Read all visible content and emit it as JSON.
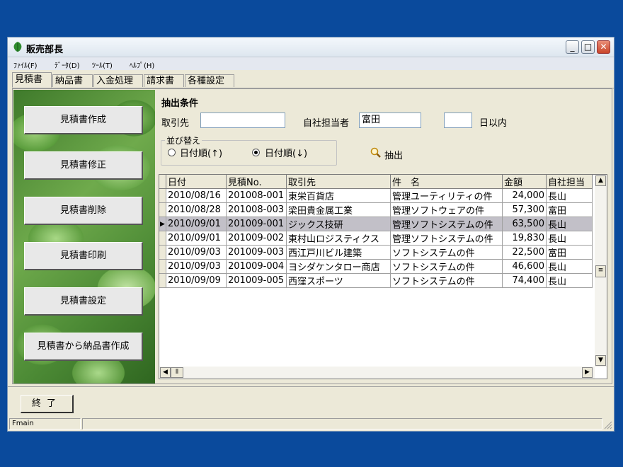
{
  "window": {
    "title": "販売部長"
  },
  "menu": [
    "ﾌｧｲﾙ(F)",
    "ﾃﾞｰﾀ(D)",
    "ﾂｰﾙ(T)",
    "ﾍﾙﾌﾟ(H)"
  ],
  "tabs": [
    "見積書",
    "納品書",
    "入金処理",
    "請求書",
    "各種設定"
  ],
  "side_buttons": [
    "見積書作成",
    "見積書修正",
    "見積書削除",
    "見積書印刷",
    "見積書設定",
    "見積書から納品書作成"
  ],
  "filter": {
    "heading": "抽出条件",
    "customer_label": "取引先",
    "customer_value": "",
    "staff_label": "自社担当者",
    "staff_value": "富田",
    "days_value": "",
    "days_label": "日以内",
    "sort_title": "並び替え",
    "sort_asc": "日付順(↑)",
    "sort_desc": "日付順(↓)",
    "sort_selected": "desc",
    "extract_label": "抽出"
  },
  "grid": {
    "columns": [
      "日付",
      "見積No.",
      "取引先",
      "件　名",
      "金額",
      "自社担当"
    ],
    "rows": [
      [
        "2010/08/16",
        "201008-001",
        "東栄百貨店",
        "管理ユーティリティの件",
        "24,000",
        "長山"
      ],
      [
        "2010/08/28",
        "201008-003",
        "梁田貴金属工業",
        "管理ソフトウェアの件",
        "57,300",
        "富田"
      ],
      [
        "2010/09/01",
        "201009-001",
        "ジックス技研",
        "管理ソフトシステムの件",
        "63,500",
        "長山"
      ],
      [
        "2010/09/01",
        "201009-002",
        "東村山ロジスティクス",
        "管理ソフトシステムの件",
        "19,830",
        "長山"
      ],
      [
        "2010/09/03",
        "201009-003",
        "西江戸川ビル建築",
        "ソフトシステムの件",
        "22,500",
        "富田"
      ],
      [
        "2010/09/03",
        "201009-004",
        "ヨシダケンタロー商店",
        "ソフトシステムの件",
        "46,600",
        "長山"
      ],
      [
        "2010/09/09",
        "201009-005",
        "西窪スポーツ",
        "ソフトシステムの件",
        "74,400",
        "長山"
      ]
    ],
    "selected_row": 2
  },
  "bottom": {
    "end_label": "終了"
  },
  "status": {
    "form_name": "Fmain"
  }
}
